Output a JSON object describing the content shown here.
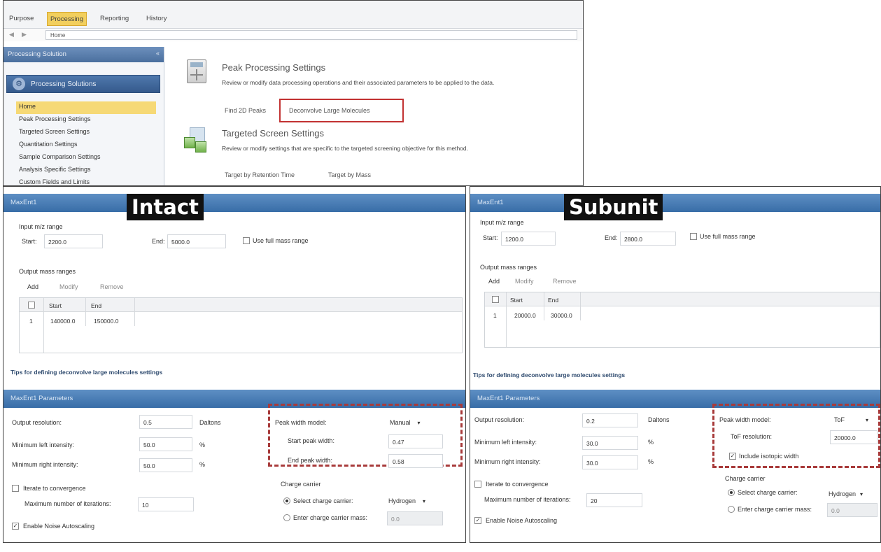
{
  "menu": {
    "items": [
      "Purpose",
      "Processing",
      "Reporting",
      "History"
    ],
    "active_index": 1
  },
  "nav": {
    "back_arrow": "◀",
    "forward_arrow": "▶",
    "address": "Home"
  },
  "sidebar": {
    "title": "Processing Solution",
    "collapse_glyph": "«",
    "section_button": "Processing Solutions",
    "items": [
      "Home",
      "Peak Processing Settings",
      "Targeted Screen Settings",
      "Quantitation Settings",
      "Sample Comparison Settings",
      "Analysis Specific Settings",
      "Custom Fields and Limits"
    ],
    "selected_index": 0
  },
  "content": {
    "peak_title": "Peak Processing Settings",
    "peak_desc": "Review or modify data processing operations and their associated parameters to be applied to the data.",
    "link_find": "Find 2D Peaks",
    "link_deconvolve": "Deconvolve Large Molecules",
    "target_title": "Targeted Screen Settings",
    "target_desc": "Review or modify settings that are specific to the targeted screening objective for this method.",
    "link_rt": "Target by Retention Time",
    "link_mass": "Target by Mass"
  },
  "intact": {
    "label": "Intact",
    "band_title": "MaxEnt1",
    "input_range_label": "Input m/z range",
    "start_label": "Start:",
    "start_value": "2200.0",
    "end_label": "End:",
    "end_value": "5000.0",
    "full_range_label": "Use full mass range",
    "output_label": "Output mass ranges",
    "add": "Add",
    "modify": "Modify",
    "remove": "Remove",
    "col_start": "Start",
    "col_end": "End",
    "row_index": "1",
    "row_start": "140000.0",
    "row_end": "150000.0",
    "tips": "Tips for defining deconvolve large molecules settings",
    "params_title": "MaxEnt1 Parameters",
    "output_res_label": "Output resolution:",
    "output_res_value": "0.5",
    "daltons": "Daltons",
    "min_left_label": "Minimum left intensity:",
    "min_left_value": "50.0",
    "min_right_label": "Minimum right intensity:",
    "min_right_value": "50.0",
    "percent": "%",
    "iterate_label": "Iterate to convergence",
    "max_iter_label": "Maximum number of iterations:",
    "max_iter_value": "10",
    "noise_label": "Enable Noise Autoscaling",
    "check_mark": "✓",
    "peak_model_label": "Peak width model:",
    "peak_model_value": "Manual",
    "dropdown_caret": "▾",
    "start_peak_label": "Start peak width:",
    "start_peak_value": "0.47",
    "end_peak_label": "End peak width:",
    "end_peak_value": "0.58",
    "charge_label": "Charge carrier",
    "select_charge_label": "Select charge carrier:",
    "select_charge_value": "Hydrogen",
    "enter_mass_label": "Enter charge carrier mass:",
    "enter_mass_value": "0.0"
  },
  "subunit": {
    "label": "Subunit",
    "band_title": "MaxEnt1",
    "input_range_label": "Input m/z range",
    "start_label": "Start:",
    "start_value": "1200.0",
    "end_label": "End:",
    "end_value": "2800.0",
    "full_range_label": "Use full mass range",
    "output_label": "Output mass ranges",
    "add": "Add",
    "modify": "Modify",
    "remove": "Remove",
    "col_start": "Start",
    "col_end": "End",
    "row_index": "1",
    "row_start": "20000.0",
    "row_end": "30000.0",
    "tips": "Tips for defining deconvolve large molecules settings",
    "params_title": "MaxEnt1 Parameters",
    "output_res_label": "Output resolution:",
    "output_res_value": "0.2",
    "daltons": "Daltons",
    "min_left_label": "Minimum left intensity:",
    "min_left_value": "30.0",
    "min_right_label": "Minimum right intensity:",
    "min_right_value": "30.0",
    "percent": "%",
    "iterate_label": "Iterate to convergence",
    "max_iter_label": "Maximum number of iterations:",
    "max_iter_value": "20",
    "noise_label": "Enable Noise Autoscaling",
    "check_mark": "✓",
    "peak_model_label": "Peak width model:",
    "peak_model_value": "ToF",
    "dropdown_caret": "▾",
    "tof_res_label": "ToF resolution:",
    "tof_res_value": "20000.0",
    "isotopic_label": "Include isotopic width",
    "charge_label": "Charge carrier",
    "select_charge_label": "Select charge carrier:",
    "select_charge_value": "Hydrogen",
    "enter_mass_label": "Enter charge carrier mass:",
    "enter_mass_value": "0.0"
  }
}
